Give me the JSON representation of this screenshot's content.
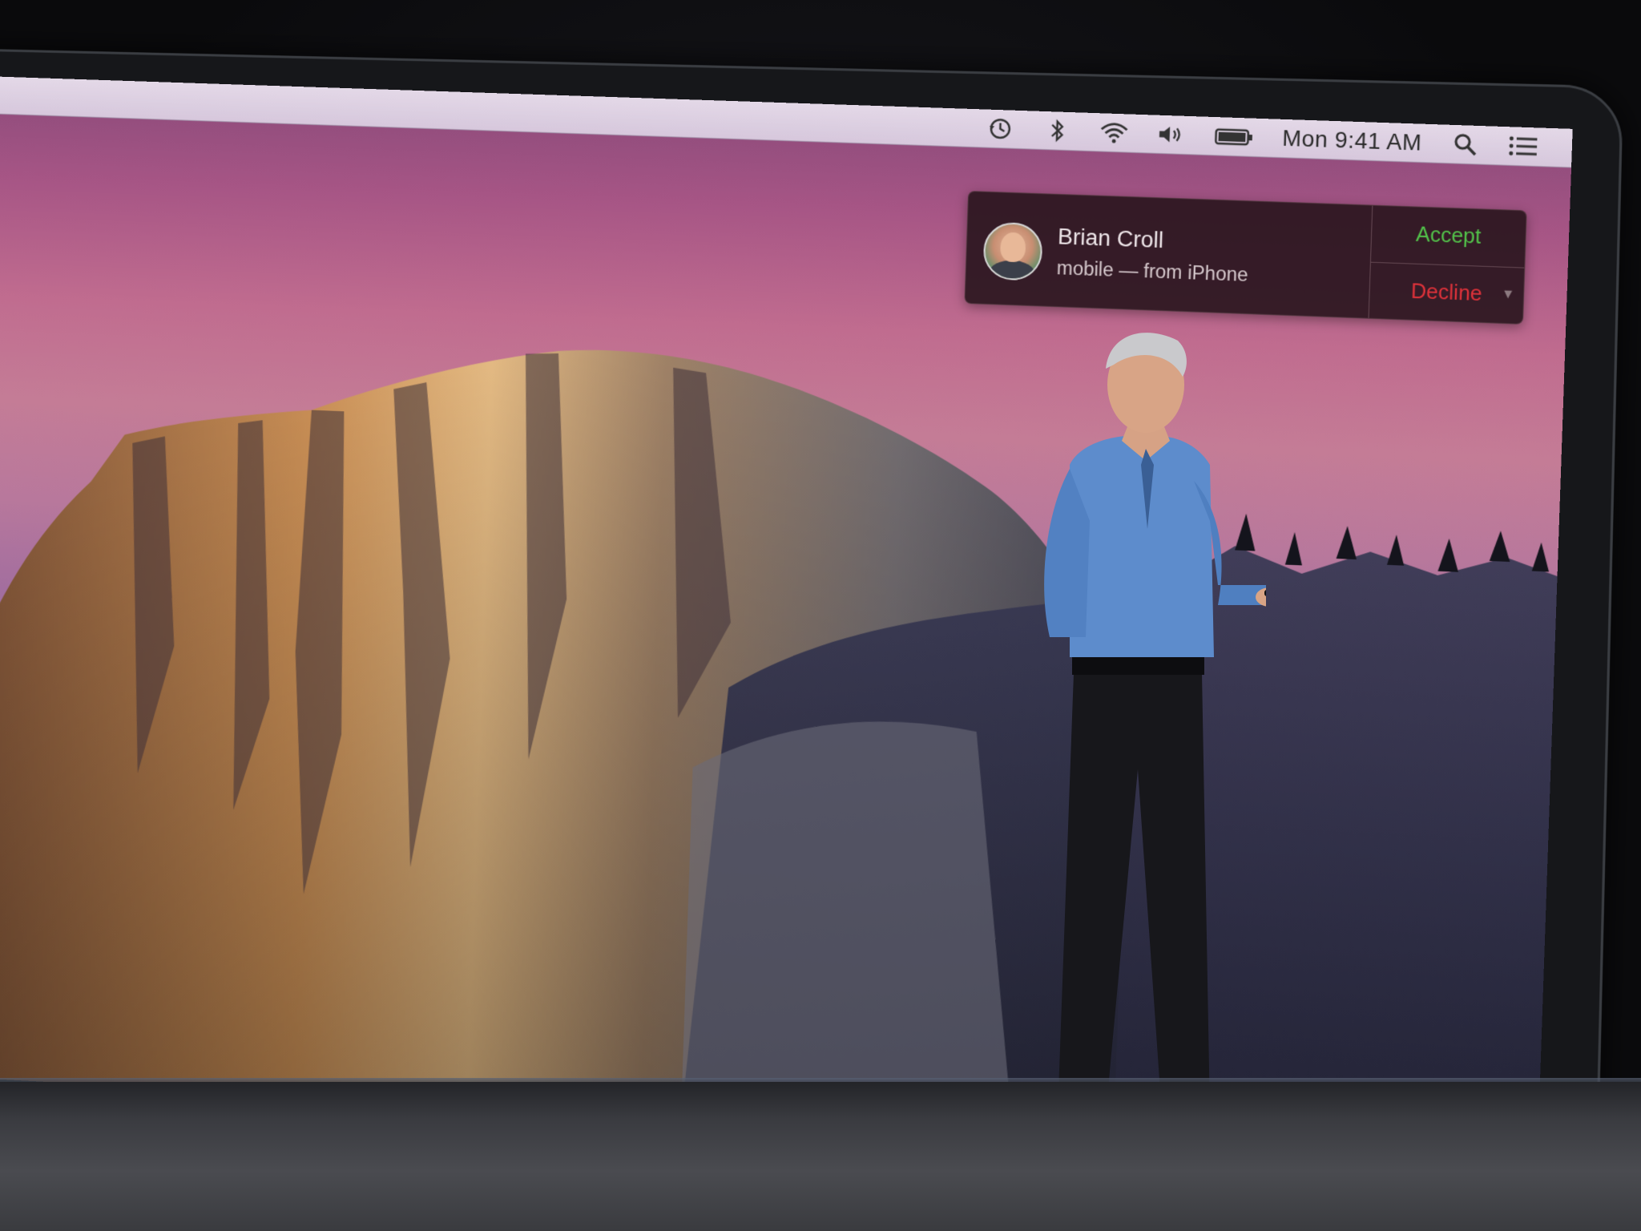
{
  "menubar": {
    "icons": [
      "time-machine-icon",
      "bluetooth-icon",
      "wifi-icon",
      "volume-icon",
      "battery-icon",
      "spotlight-search-icon",
      "notification-center-icon"
    ],
    "clock": "Mon 9:41 AM"
  },
  "notification": {
    "caller_name": "Brian Croll",
    "caller_detail": "mobile — from iPhone",
    "accept_label": "Accept",
    "decline_label": "Decline"
  },
  "colors": {
    "accept": "#52c24a",
    "decline": "#e0323a",
    "notification_bg": "#2a161e"
  }
}
